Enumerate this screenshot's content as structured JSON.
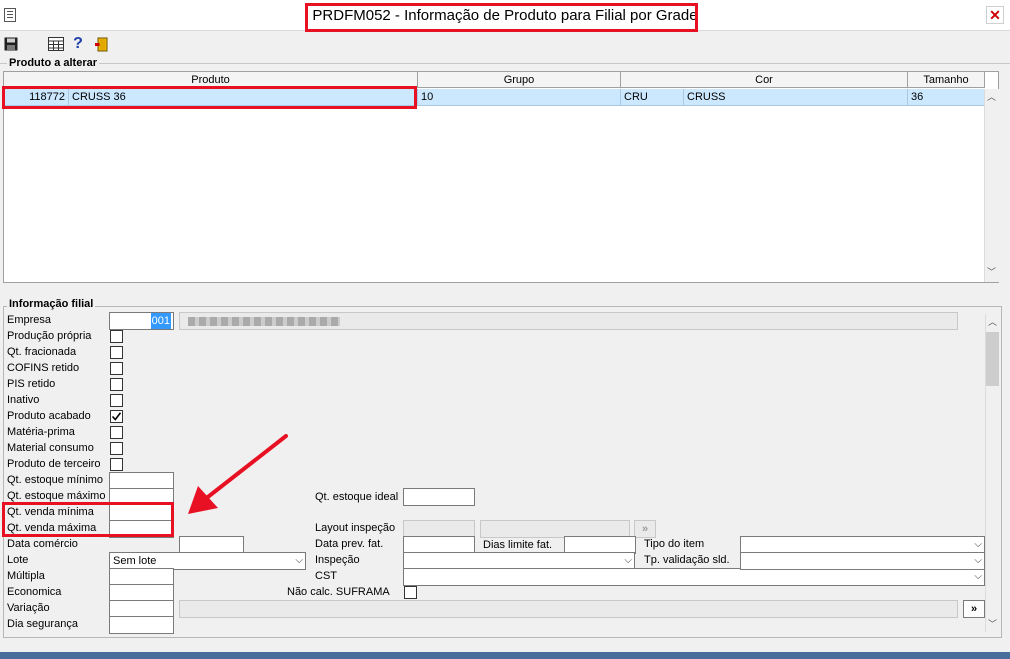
{
  "window": {
    "title": "PRDFM052 - Informação de Produto para Filial por Grade",
    "close_glyph": "✕"
  },
  "toolbar": {
    "icons": [
      "save-icon",
      "calculator-icon",
      "help-icon",
      "exit-icon"
    ],
    "help_glyph": "?"
  },
  "grid": {
    "section_label": "Produto a alterar",
    "headers": [
      "Produto",
      "Grupo",
      "Cor",
      "Tamanho"
    ],
    "row": {
      "code": "118772",
      "name": "CRUSS 36",
      "grupo": "10",
      "cor_code": "CRU",
      "cor_name": "CRUSS",
      "tamanho": "36"
    }
  },
  "info": {
    "section_label": "Informação filial",
    "empresa": {
      "label": "Empresa",
      "value": "001"
    },
    "checkboxes": [
      {
        "label": "Produção própria",
        "checked": false
      },
      {
        "label": "Qt. fracionada",
        "checked": false
      },
      {
        "label": "COFINS retido",
        "checked": false
      },
      {
        "label": "PIS retido",
        "checked": false
      },
      {
        "label": "Inativo",
        "checked": false
      },
      {
        "label": "Produto acabado",
        "checked": true
      },
      {
        "label": "Matéria-prima",
        "checked": false
      },
      {
        "label": "Material consumo",
        "checked": false
      },
      {
        "label": "Produto de terceiro",
        "checked": false
      }
    ],
    "qt_estoque_minimo": "Qt. estoque mínimo",
    "qt_estoque_maximo": "Qt. estoque máximo",
    "qt_venda_minima": "Qt. venda mínima",
    "qt_venda_maxima": "Qt. venda máxima",
    "data_comercio": "Data comércio",
    "lote": {
      "label": "Lote",
      "value": "Sem lote"
    },
    "multipla": "Múltipla",
    "economica": "Economica",
    "variacao": "Variação",
    "dia_seguranca": "Dia segurança",
    "qt_estoque_ideal": "Qt. estoque ideal",
    "layout_inspecao": "Layout inspeção",
    "data_prev_fat": "Data prev. fat.",
    "dias_limite_fat": "Dias limite fat.",
    "inspecao": "Inspeção",
    "cst": "CST",
    "nao_calc_suframa": "Não calc. SUFRAMA",
    "tipo_do_item": "Tipo do item",
    "tp_validacao_sld": "Tp. validação sld.",
    "browse_glyph": "»"
  },
  "colors": {
    "selection": "#cce8ff",
    "annotation": "#e81123",
    "highlight": "#3399ff"
  }
}
